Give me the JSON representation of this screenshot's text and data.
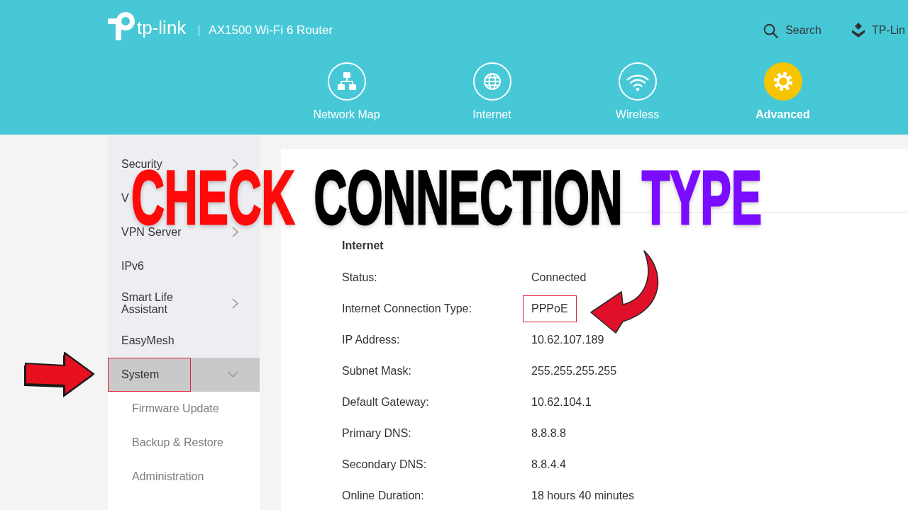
{
  "header": {
    "logo_text": "tp-link",
    "model": "AX1500 Wi-Fi 6 Router",
    "search_label": "Search",
    "account_label": "TP-Lin"
  },
  "nav_tabs": [
    {
      "label": "Network Map",
      "selected": false
    },
    {
      "label": "Internet",
      "selected": false
    },
    {
      "label": "Wireless",
      "selected": false
    },
    {
      "label": "Advanced",
      "selected": true
    }
  ],
  "sidebar": {
    "items": [
      {
        "label": "Security",
        "expanded": false,
        "selected": false,
        "highlighted": false
      },
      {
        "label": "V",
        "selected": false,
        "highlighted": false
      },
      {
        "label": "VPN Server",
        "expanded": false,
        "selected": false,
        "highlighted": false
      },
      {
        "label": "IPv6",
        "selected": false,
        "highlighted": false
      },
      {
        "label": "Smart Life Assistant",
        "expanded": false,
        "selected": false,
        "highlighted": false
      },
      {
        "label": "EasyMesh",
        "selected": false,
        "highlighted": false
      },
      {
        "label": "System",
        "expanded": true,
        "selected": true,
        "highlighted": true,
        "children": [
          {
            "label": "Firmware Update",
            "selected": false
          },
          {
            "label": "Backup & Restore",
            "selected": false
          },
          {
            "label": "Administration",
            "selected": false
          }
        ]
      }
    ]
  },
  "content": {
    "section_title": "Internet",
    "rows": [
      {
        "label": "Status:",
        "value": "Connected",
        "highlighted": false
      },
      {
        "label": "Internet Connection Type:",
        "value": "PPPoE",
        "highlighted": true
      },
      {
        "label": "IP Address:",
        "value": "10.62.107.189",
        "highlighted": false
      },
      {
        "label": "Subnet Mask:",
        "value": "255.255.255.255",
        "highlighted": false
      },
      {
        "label": "Default Gateway:",
        "value": "10.62.104.1",
        "highlighted": false
      },
      {
        "label": "Primary DNS:",
        "value": "8.8.8.8",
        "highlighted": false
      },
      {
        "label": "Secondary DNS:",
        "value": "8.8.4.4",
        "highlighted": false
      },
      {
        "label": "Online Duration:",
        "value": "18 hours 40 minutes",
        "highlighted": false
      }
    ]
  },
  "headline": [
    {
      "text": "CHECK",
      "color": "#ff0a0a"
    },
    {
      "text": "CONNECTION",
      "color": "#000000"
    },
    {
      "text": "TYPE",
      "color": "#7a0cff"
    }
  ]
}
